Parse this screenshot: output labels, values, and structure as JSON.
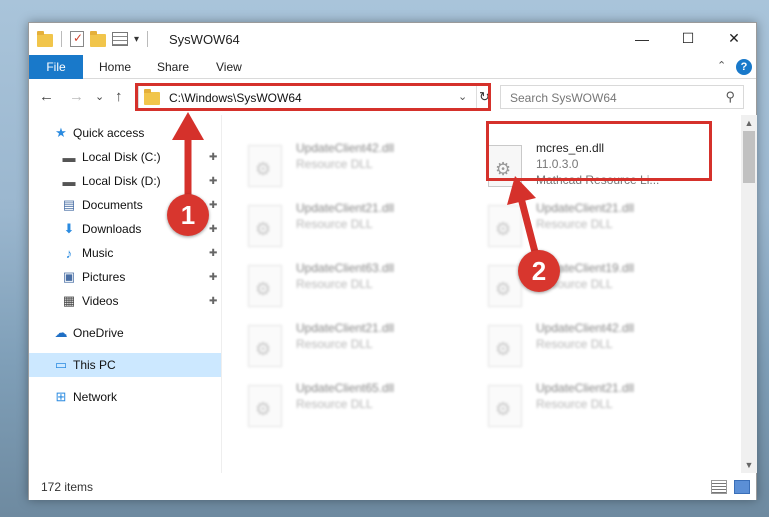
{
  "window": {
    "title": "SysWOW64",
    "minimize_glyph": "—",
    "maximize_glyph": "☐",
    "close_glyph": "✕"
  },
  "ribbon": {
    "tabs": [
      "File",
      "Home",
      "Share",
      "View"
    ],
    "help_glyph": "?",
    "collapse_glyph": "⌃"
  },
  "nav": {
    "back_glyph": "←",
    "forward_glyph": "→",
    "recent_glyph": "⌄",
    "up_glyph": "↑",
    "address": "C:\\Windows\\SysWOW64",
    "address_dropdown_glyph": "⌄",
    "refresh_glyph": "↻",
    "search_placeholder": "Search SysWOW64",
    "search_glyph": "⚲"
  },
  "sidebar": {
    "items": [
      {
        "label": "Quick access",
        "icon": "star-icon",
        "glyph": "★",
        "color": "#2b8be0",
        "pinned": false
      },
      {
        "label": "Local Disk (C:)",
        "icon": "drive-icon",
        "glyph": "▬",
        "color": "#555555",
        "pinned": true
      },
      {
        "label": "Local Disk (D:)",
        "icon": "drive-icon",
        "glyph": "▬",
        "color": "#555555",
        "pinned": true
      },
      {
        "label": "Documents",
        "icon": "document-icon",
        "glyph": "▤",
        "color": "#4a6fa5",
        "pinned": true
      },
      {
        "label": "Downloads",
        "icon": "download-icon",
        "glyph": "⬇",
        "color": "#2b8be0",
        "pinned": true
      },
      {
        "label": "Music",
        "icon": "music-icon",
        "glyph": "♪",
        "color": "#2b8be0",
        "pinned": true
      },
      {
        "label": "Pictures",
        "icon": "pictures-icon",
        "glyph": "▣",
        "color": "#4a6fa5",
        "pinned": true
      },
      {
        "label": "Videos",
        "icon": "video-icon",
        "glyph": "▦",
        "color": "#444444",
        "pinned": true
      },
      {
        "label": "OneDrive",
        "icon": "cloud-icon",
        "glyph": "☁",
        "color": "#1f6fc5",
        "pinned": false
      },
      {
        "label": "This PC",
        "icon": "computer-icon",
        "glyph": "▭",
        "color": "#2b8be0",
        "pinned": false
      },
      {
        "label": "Network",
        "icon": "network-icon",
        "glyph": "⊞",
        "color": "#2b8be0",
        "pinned": false
      }
    ],
    "pin_glyph": "📌"
  },
  "files": {
    "highlighted": {
      "name": "mcres_en.dll",
      "version": "11.0.3.0",
      "description": "Mathcad Resource Li..."
    },
    "blurred": [
      {
        "name": "UpdateClient42.dll",
        "type": "Resource DLL"
      },
      {
        "name": "UpdateClient21.dll",
        "type": "Resource DLL"
      },
      {
        "name": "UpdateClient21.dll",
        "type": "Resource DLL"
      },
      {
        "name": "UpdateClient63.dll",
        "type": "Resource DLL"
      },
      {
        "name": "UpdateClient19.dll",
        "type": "Resource DLL"
      },
      {
        "name": "UpdateClient21.dll",
        "type": "Resource DLL"
      },
      {
        "name": "UpdateClient42.dll",
        "type": "Resource DLL"
      },
      {
        "name": "UpdateClient65.dll",
        "type": "Resource DLL"
      },
      {
        "name": "UpdateClient21.dll",
        "type": "Resource DLL"
      }
    ]
  },
  "status": {
    "item_count": "172 items"
  },
  "annotations": {
    "step1": "1",
    "step2": "2",
    "color": "#d5312b"
  }
}
